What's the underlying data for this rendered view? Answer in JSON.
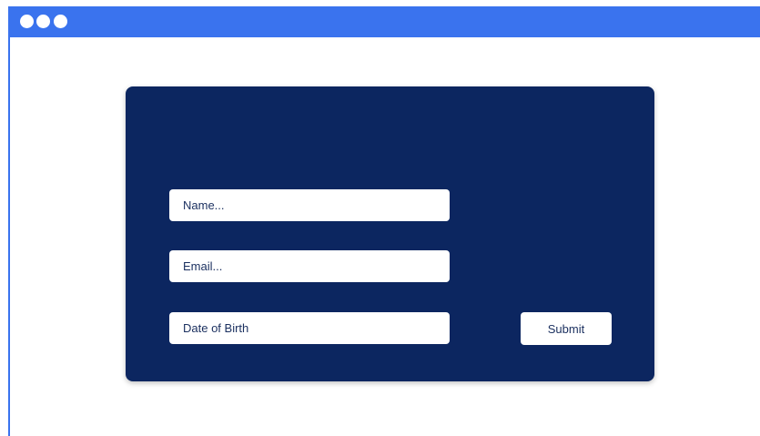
{
  "window": {
    "titlebar_color": "#3a73ee",
    "controls": [
      "window-dot",
      "window-dot",
      "window-dot"
    ]
  },
  "form": {
    "background_color": "#0c2660",
    "fields": {
      "name": {
        "placeholder": "Name..."
      },
      "email": {
        "placeholder": "Email..."
      },
      "dob": {
        "placeholder": "Date of Birth"
      }
    },
    "submit_label": "Submit"
  }
}
